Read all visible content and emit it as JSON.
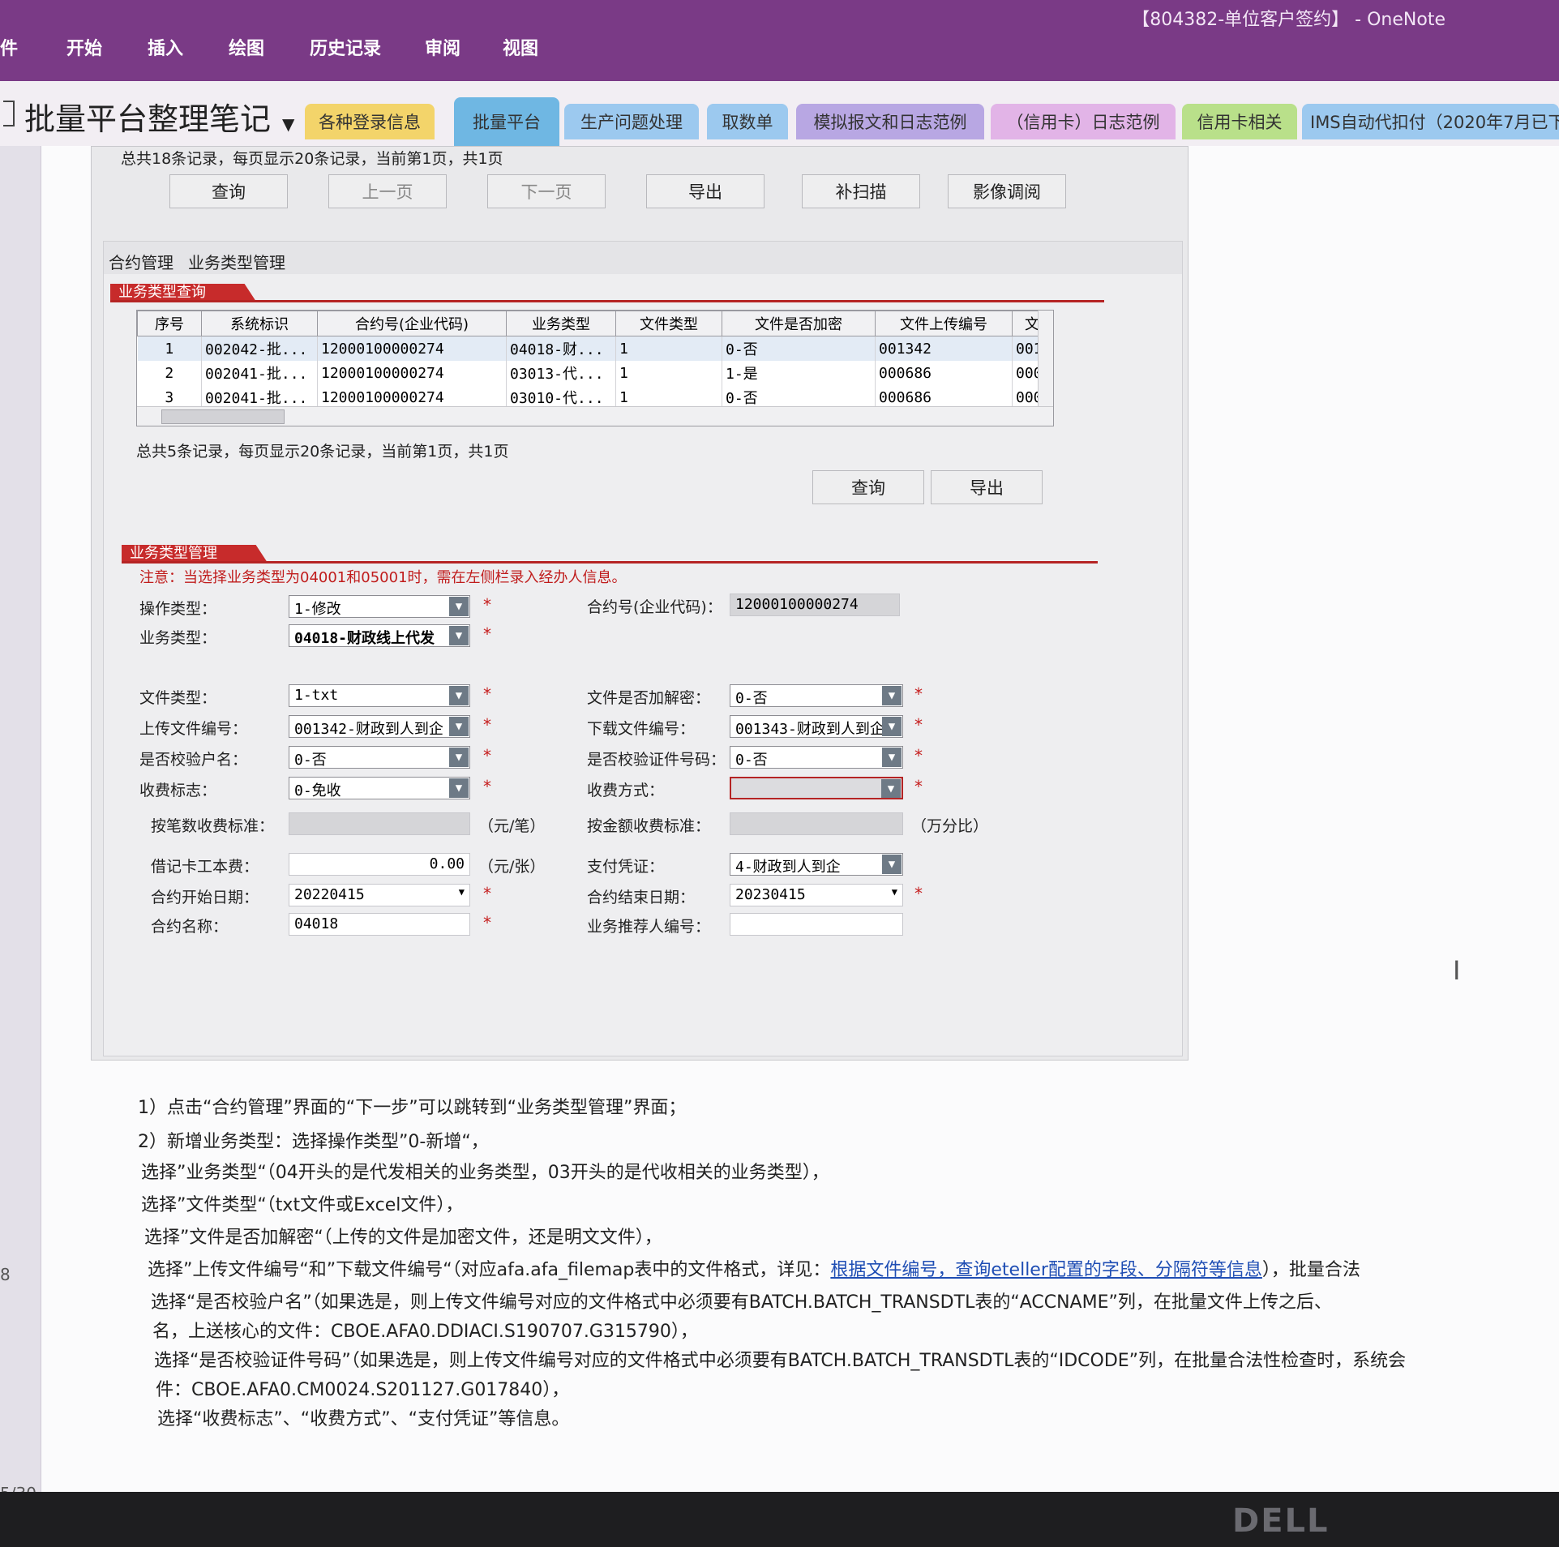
{
  "window": {
    "title": "【804382-单位客户签约】 - OneNote"
  },
  "menu": [
    "件",
    "开始",
    "插入",
    "绘图",
    "历史记录",
    "审阅",
    "视图"
  ],
  "notebook": {
    "title": "批量平台整理笔记"
  },
  "tabs": [
    "各种登录信息",
    "批量平台",
    "生产问题处理",
    "取数单",
    "模拟报文和日志范例",
    "（信用卡）日志范例",
    "信用卡相关",
    "IMS自动代扣付（2020年7月已下"
  ],
  "left_numbers": [
    "8",
    "5/30"
  ],
  "top_summary": "总共18条记录，每页显示20条记录，当前第1页，共1页",
  "top_buttons": [
    "查询",
    "上一页",
    "下一页",
    "导出",
    "补扫描",
    "影像调阅"
  ],
  "subtabs": [
    "合约管理",
    "业务类型管理"
  ],
  "query_section": {
    "title": "业务类型查询",
    "columns": [
      "序号",
      "系统标识",
      "合约号(企业代码)",
      "业务类型",
      "文件类型",
      "文件是否加密",
      "文件上传编号",
      "文"
    ],
    "rows": [
      [
        "1",
        "002042-批...",
        "12000100000274",
        "04018-财...",
        "1",
        "0-否",
        "001342",
        "001"
      ],
      [
        "2",
        "002041-批...",
        "12000100000274",
        "03013-代...",
        "1",
        "1-是",
        "000686",
        "000"
      ],
      [
        "3",
        "002041-批...",
        "12000100000274",
        "03010-代...",
        "1",
        "0-否",
        "000686",
        "000"
      ]
    ],
    "summary": "总共5条记录，每页显示20条记录，当前第1页，共1页",
    "buttons": [
      "查询",
      "导出"
    ]
  },
  "manage_section": {
    "title": "业务类型管理",
    "notice": "注意：当选择业务类型为04001和05001时，需在左侧栏录入经办人信息。",
    "op_type": {
      "label": "操作类型：",
      "value": "1-修改"
    },
    "contract_no": {
      "label": "合约号(企业代码)：",
      "value": "12000100000274"
    },
    "biz_type": {
      "label": "业务类型：",
      "value": "04018-财政线上代发"
    },
    "file_type": {
      "label": "文件类型：",
      "value": "1-txt"
    },
    "encrypt": {
      "label": "文件是否加解密：",
      "value": "0-否"
    },
    "upload_no": {
      "label": "上传文件编号：",
      "value": "001342-财政到人到企"
    },
    "download_no": {
      "label": "下载文件编号：",
      "value": "001343-财政到人到企"
    },
    "check_name": {
      "label": "是否校验户名：",
      "value": "0-否"
    },
    "check_id": {
      "label": "是否校验证件号码：",
      "value": "0-否"
    },
    "fee_flag": {
      "label": "收费标志：",
      "value": "0-免收"
    },
    "fee_mode": {
      "label": "收费方式：",
      "value": ""
    },
    "fee_per_item": {
      "label": "按笔数收费标准：",
      "unit": "（元/笔）"
    },
    "fee_per_amount": {
      "label": "按金额收费标准：",
      "unit": "（万分比）"
    },
    "card_fee": {
      "label": "借记卡工本费：",
      "value": "0.00",
      "unit": "（元/张）"
    },
    "voucher": {
      "label": "支付凭证：",
      "value": "4-财政到人到企"
    },
    "start_date": {
      "label": "合约开始日期：",
      "value": "20220415"
    },
    "end_date": {
      "label": "合约结束日期：",
      "value": "20230415"
    },
    "contract_name": {
      "label": "合约名称：",
      "value": "04018"
    },
    "referrer": {
      "label": "业务推荐人编号：",
      "value": ""
    },
    "required_mark": "*"
  },
  "notes": {
    "l1": "1）点击“合约管理”界面的“下一步”可以跳转到“业务类型管理”界面；",
    "l2": "2）新增业务类型：选择操作类型”0-新增“，",
    "l3": "选择”业务类型“（04开头的是代发相关的业务类型，03开头的是代收相关的业务类型），",
    "l4": "选择”文件类型“（txt文件或Excel文件），",
    "l5": "选择”文件是否加解密“（上传的文件是加密文件，还是明文文件），",
    "l6a": "选择”上传文件编号“和”下载文件编号“（对应afa.afa_filemap表中的文件格式，详见：",
    "l6link": "根据文件编号，查询eteller配置的字段、分隔符等信息",
    "l6b": "），",
    "l6c": "批量合法",
    "l7": "选择“是否校验户名”（如果选是，则上传文件编号对应的文件格式中必须要有BATCH.BATCH_TRANSDTL表的“ACCNAME”列，在批量文件上传之后、",
    "l8": "名，上送核心的文件：CBOE.AFA0.DDIACI.S190707.G315790），",
    "l9": "选择“是否校验证件号码”（如果选是，则上传文件编号对应的文件格式中必须要有BATCH.BATCH_TRANSDTL表的“IDCODE”列，在批量合法性检查时，系统会",
    "l10": "件：CBOE.AFA0.CM0024.S201127.G017840），",
    "l11": "选择“收费标志”、“收费方式”、“支付凭证”等信息。"
  },
  "brand": "DELL"
}
